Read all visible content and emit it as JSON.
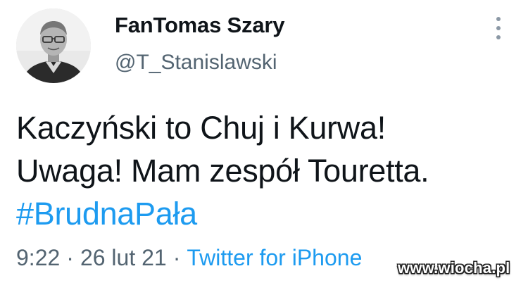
{
  "user": {
    "display_name": "FanTomas Szary",
    "handle": "@T_Stanislawski",
    "avatar": "profile-photo"
  },
  "tweet": {
    "lines": [
      "Kaczyński to Chuj i Kurwa!",
      "Uwaga! Mam zespół Touretta."
    ],
    "hashtag": "#BrudnaPała",
    "time": "9:22",
    "date": "26 lut 21",
    "separator": "·",
    "source": "Twitter for iPhone"
  },
  "watermark": "www.wiocha.pl",
  "icons": {
    "more": "more-vertical-icon"
  },
  "colors": {
    "text": "#0f1419",
    "secondary": "#536471",
    "link": "#1d9bf0"
  }
}
